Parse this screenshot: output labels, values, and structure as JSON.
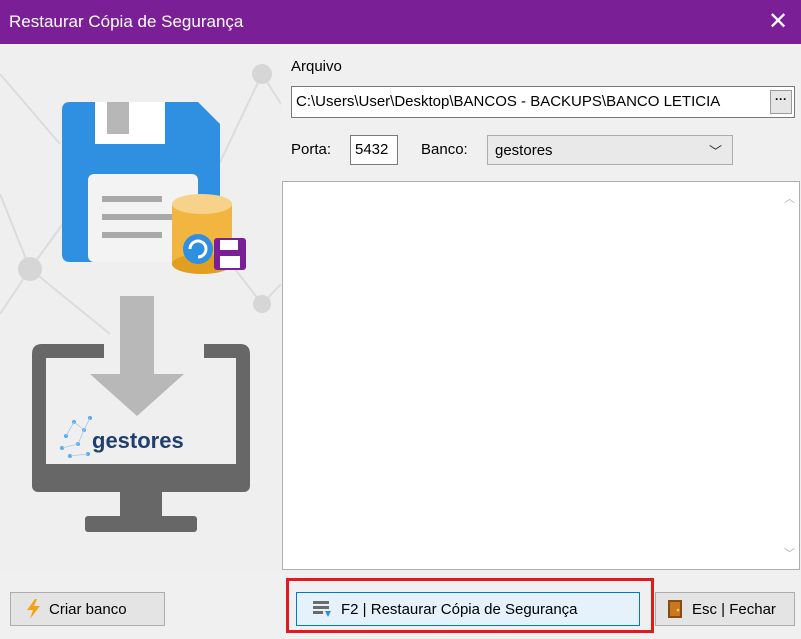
{
  "window": {
    "title": "Restaurar Cópia de Segurança",
    "close_icon": "close-icon"
  },
  "colors": {
    "titlebar": "#7b1f96",
    "highlight": "#e01b1b",
    "floppy": "#2f8fe0"
  },
  "illustration": {
    "brand": "gestores",
    "icons": [
      "floppy-disk-icon",
      "database-icon",
      "download-arrow-icon",
      "monitor-icon",
      "gestores-logo"
    ]
  },
  "form": {
    "file_label": "Arquivo",
    "file_path": "C:\\Users\\User\\Desktop\\BANCOS - BACKUPS\\BANCO LETICIA",
    "browse_label": "···",
    "port_label": "Porta:",
    "port_value": "5432",
    "db_label": "Banco:",
    "db_value": "gestores"
  },
  "buttons": {
    "create": "Criar banco",
    "restore": "F2 | Restaurar Cópia de Segurança",
    "close": "Esc | Fechar"
  }
}
